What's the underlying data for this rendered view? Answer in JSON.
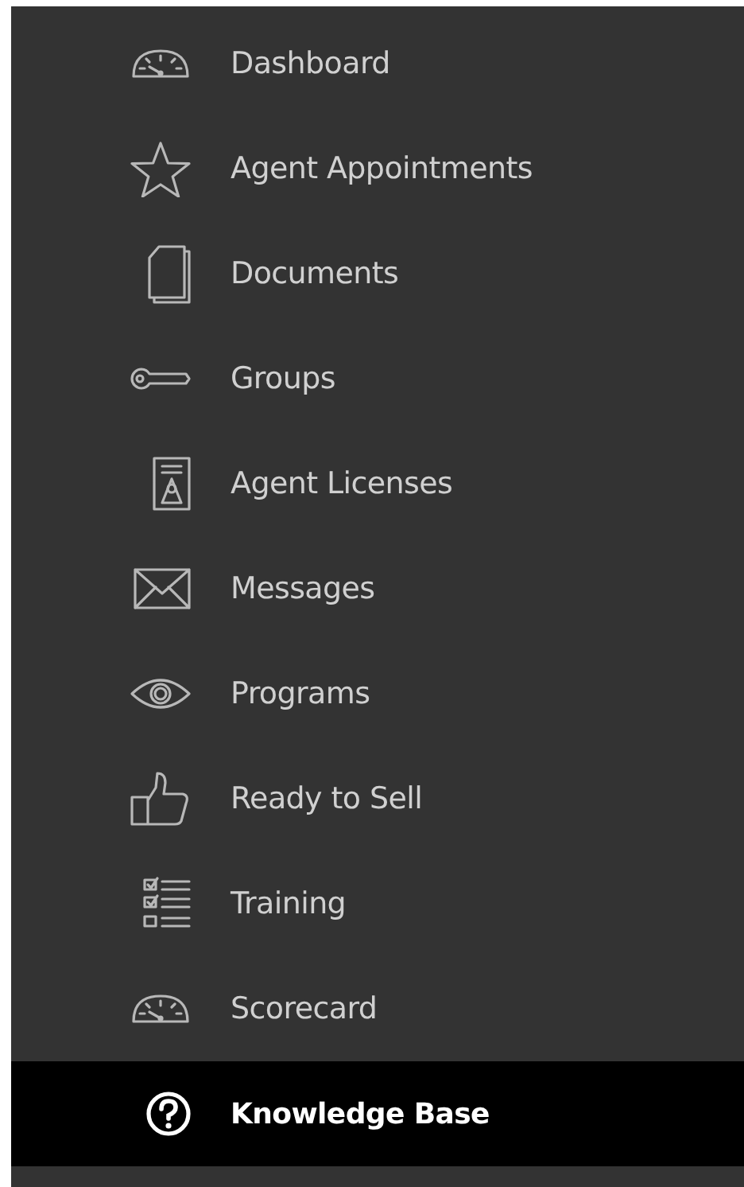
{
  "sidebar": {
    "items": [
      {
        "label": "Dashboard",
        "selected": false
      },
      {
        "label": "Agent Appointments",
        "selected": false
      },
      {
        "label": "Documents",
        "selected": false
      },
      {
        "label": "Groups",
        "selected": false
      },
      {
        "label": "Agent Licenses",
        "selected": false
      },
      {
        "label": "Messages",
        "selected": false
      },
      {
        "label": "Programs",
        "selected": false
      },
      {
        "label": "Ready to Sell",
        "selected": false
      },
      {
        "label": "Training",
        "selected": false
      },
      {
        "label": "Scorecard",
        "selected": false
      },
      {
        "label": "Knowledge Base",
        "selected": true
      }
    ]
  }
}
